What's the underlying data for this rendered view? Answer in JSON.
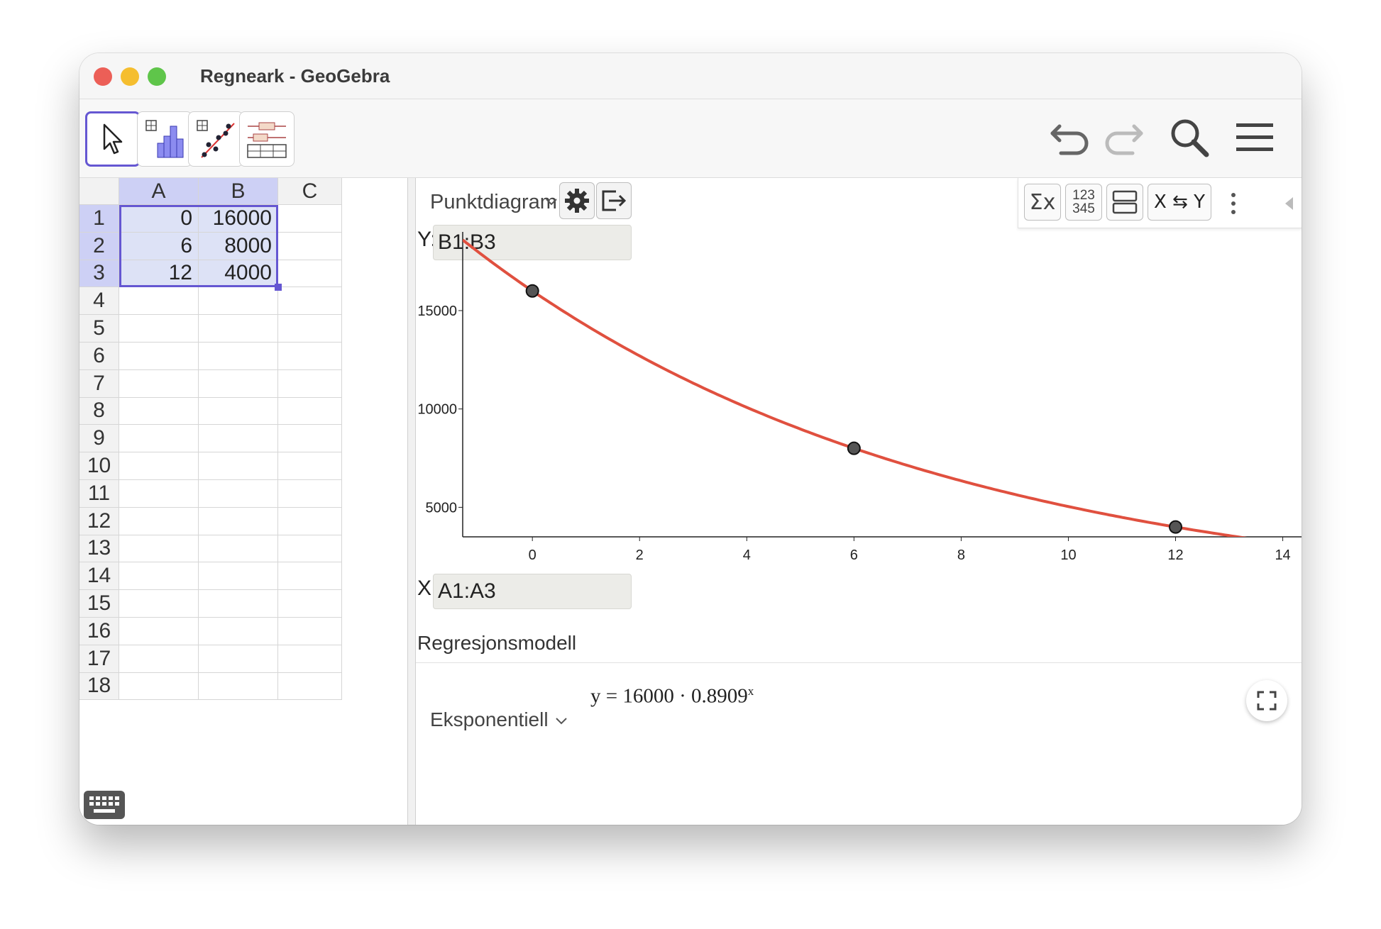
{
  "window": {
    "title": "Regneark - GeoGebra"
  },
  "toolbar": {
    "tools": [
      "move-tool",
      "one-variable-analysis-tool",
      "two-variable-regression-tool",
      "multi-variable-analysis-tool"
    ],
    "undo_icon": "undo-icon",
    "redo_icon": "redo-icon",
    "search_icon": "search-icon",
    "menu_icon": "menu-icon"
  },
  "sheet": {
    "columns": [
      "A",
      "B",
      "C"
    ],
    "row_numbers": [
      "1",
      "2",
      "3",
      "4",
      "5",
      "6",
      "7",
      "8",
      "9",
      "10",
      "11",
      "12",
      "13",
      "14",
      "15",
      "16",
      "17",
      "18"
    ],
    "cells": [
      {
        "a": "0",
        "b": "16000"
      },
      {
        "a": "6",
        "b": "8000"
      },
      {
        "a": "12",
        "b": "4000"
      }
    ]
  },
  "panel": {
    "plot_type": "Punktdiagram",
    "y_label": "Y:",
    "y_range": "B1:B3",
    "x_label": "X:",
    "x_range": "A1:A3",
    "stats_buttons": [
      "Σx",
      "123 345",
      "layout",
      "X ⇆ Y"
    ],
    "model_heading": "Regresjonsmodell",
    "model_type": "Eksponentiell",
    "equation": {
      "lhs": "y",
      "eq": "=",
      "body": "16000 · 0.8909",
      "exp": "x"
    }
  },
  "chart_data": {
    "type": "scatter",
    "x_ticks": [
      0,
      2,
      4,
      6,
      8,
      10,
      12,
      14
    ],
    "y_ticks": [
      5000,
      10000,
      15000
    ],
    "y_tick_labels": [
      "5000",
      "10000",
      "15000"
    ],
    "x_tick_labels": [
      "0",
      "2",
      "4",
      "6",
      "8",
      "10",
      "12",
      "14"
    ],
    "xlim": [
      -1.3,
      14.35
    ],
    "ylim": [
      3500,
      19000
    ],
    "points": [
      {
        "x": 0,
        "y": 16000
      },
      {
        "x": 6,
        "y": 8000
      },
      {
        "x": 12,
        "y": 4000
      }
    ],
    "fit": {
      "model": "exponential",
      "a": 16000,
      "b": 0.8909,
      "color": "#e0503f"
    },
    "point_color": "#555555"
  }
}
